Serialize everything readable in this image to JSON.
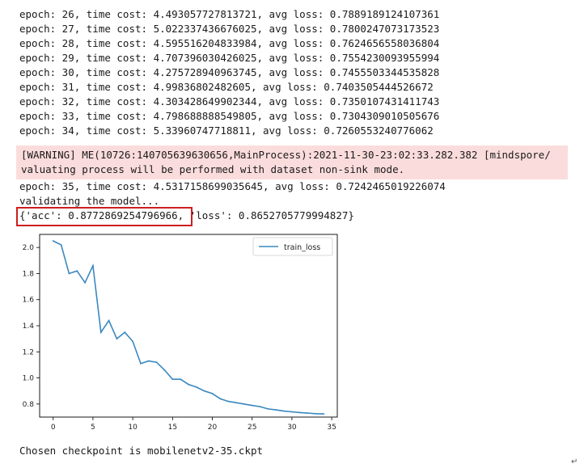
{
  "output": {
    "partial_top_line": "·   ·       ·                                    ·",
    "epoch_lines": [
      "epoch: 26, time cost: 4.493057727813721, avg loss: 0.7889189124107361",
      "epoch: 27, time cost: 5.022337436676025, avg loss: 0.7800247073173523",
      "epoch: 28, time cost: 4.595516204833984, avg loss: 0.7624656558036804",
      "epoch: 29, time cost: 4.707396030426025, avg loss: 0.7554230093955994",
      "epoch: 30, time cost: 4.275728940963745, avg loss: 0.7455503344535828",
      "epoch: 31, time cost: 4.99836802482605, avg loss: 0.7403505444526672",
      "epoch: 32, time cost: 4.303428649902344, avg loss: 0.7350107431411743",
      "epoch: 33, time cost: 4.798688888549805, avg loss: 0.7304309010505676",
      "epoch: 34, time cost: 5.33960747718811, avg loss: 0.7260553240776062"
    ],
    "warning_line1": "[WARNING] ME(10726:140705639630656,MainProcess):2021-11-30-23:02:33.282.382 [mindspore/",
    "warning_line2": "valuating process will be performed with dataset non-sink mode.",
    "epoch_35_line": "epoch: 35, time cost: 4.5317158699035645, avg loss: 0.7242465019226074",
    "validating_line": "validating the model...",
    "result_line": "{'acc': 0.8772869254796966, 'loss': 0.8652705779994827}",
    "footer_line": "Chosen checkpoint is mobilenetv2-35.ckpt",
    "return_mark": "↵"
  },
  "colors": {
    "warning_bg": "#fbdcdc",
    "highlight_border": "#cc1f1f",
    "line_color": "#3a88c0"
  },
  "chart_data": {
    "type": "line",
    "x_ticks": [
      0,
      5,
      10,
      15,
      20,
      25,
      30,
      35
    ],
    "y_ticks": [
      "0.8",
      "1.0",
      "1.2",
      "1.4",
      "1.6",
      "1.8",
      "2.0"
    ],
    "y_tick_values": [
      0.8,
      1.0,
      1.2,
      1.4,
      1.6,
      1.8,
      2.0
    ],
    "xlim": [
      -1.7,
      35.7
    ],
    "ylim": [
      0.7,
      2.1
    ],
    "legend_position": "top-right",
    "series": [
      {
        "name": "train_loss",
        "x": [
          0,
          1,
          2,
          3,
          4,
          5,
          6,
          7,
          8,
          9,
          10,
          11,
          12,
          13,
          14,
          15,
          16,
          17,
          18,
          19,
          20,
          21,
          22,
          23,
          24,
          25,
          26,
          27,
          28,
          29,
          30,
          31,
          32,
          33,
          34
        ],
        "values": [
          2.05,
          2.02,
          1.8,
          1.82,
          1.73,
          1.86,
          1.35,
          1.44,
          1.3,
          1.35,
          1.28,
          1.11,
          1.13,
          1.12,
          1.06,
          0.99,
          0.99,
          0.95,
          0.93,
          0.9,
          0.88,
          0.84,
          0.82,
          0.81,
          0.8,
          0.7889,
          0.78,
          0.7625,
          0.7554,
          0.7456,
          0.7404,
          0.735,
          0.7304,
          0.7261,
          0.7242
        ]
      }
    ]
  }
}
